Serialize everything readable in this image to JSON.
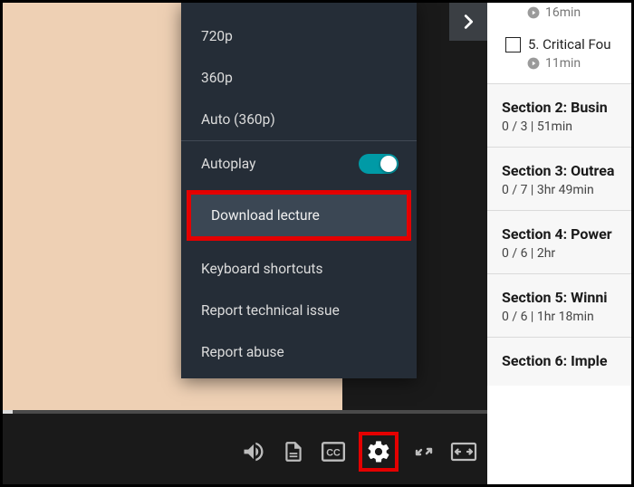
{
  "menu": {
    "quality": [
      "720p",
      "360p",
      "Auto (360p)"
    ],
    "autoplay_label": "Autoplay",
    "autoplay_on": true,
    "download_label": "Download lecture",
    "shortcuts_label": "Keyboard shortcuts",
    "report_tech_label": "Report technical issue",
    "report_abuse_label": "Report abuse"
  },
  "sidebar": {
    "top_duration": "16min",
    "lesson": {
      "label": "5. Critical Fou",
      "duration": "11min"
    },
    "sections": [
      {
        "title": "Section 2: Busin",
        "meta": "0 / 3 | 51min"
      },
      {
        "title": "Section 3: Outrea",
        "meta": "0 / 7 | 3hr 49min"
      },
      {
        "title": "Section 4: Power",
        "meta": "0 / 6 | 2hr"
      },
      {
        "title": "Section 5: Winni",
        "meta": "0 / 6 | 1hr 18min"
      },
      {
        "title": "Section 6: Imple",
        "meta": ""
      }
    ]
  }
}
